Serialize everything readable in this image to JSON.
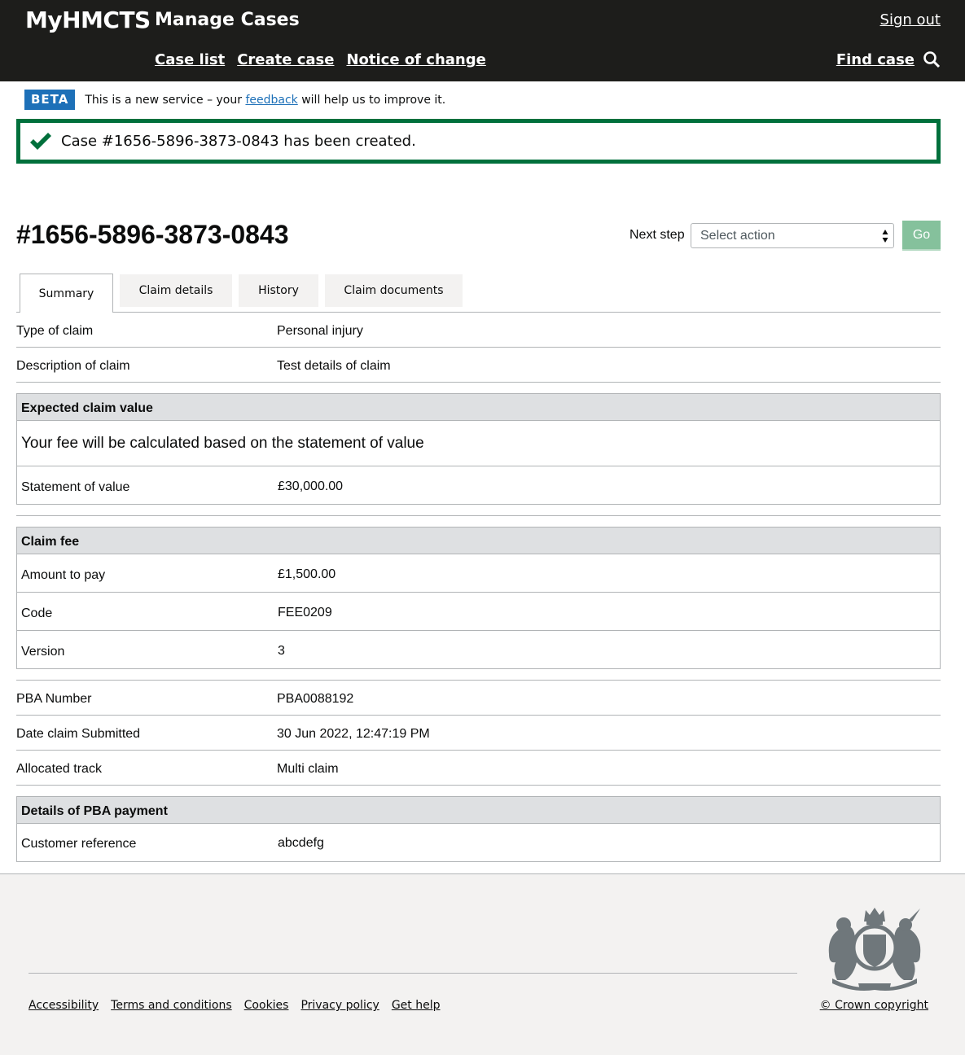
{
  "header": {
    "brand": "MyHMCTS",
    "service_name": "Manage Cases",
    "sign_out": "Sign out",
    "nav": [
      "Case list",
      "Create case",
      "Notice of change"
    ],
    "find_case": "Find case"
  },
  "beta": {
    "tag": "BETA",
    "text_before": "This is a new service – your ",
    "link": "feedback",
    "text_after": " will help us to improve it."
  },
  "alert": {
    "message": "Case #1656-5896-3873-0843 has been created.",
    "color": "#00703c"
  },
  "case": {
    "title": "#1656-5896-3873-0843",
    "next_step_label": "Next step",
    "select_placeholder": "Select action",
    "go_label": "Go"
  },
  "tabs": [
    "Summary",
    "Claim details",
    "History",
    "Claim documents"
  ],
  "summary": {
    "type_of_claim": {
      "label": "Type of claim",
      "value": "Personal injury"
    },
    "description": {
      "label": "Description of claim",
      "value": "Test details of claim"
    },
    "expected_claim_value": {
      "heading": "Expected claim value",
      "note": "Your fee will be calculated based on the statement of value",
      "statement_label": "Statement of value",
      "statement_value": "£30,000.00"
    },
    "claim_fee": {
      "heading": "Claim fee",
      "rows": [
        {
          "label": "Amount to pay",
          "value": "£1,500.00"
        },
        {
          "label": "Code",
          "value": "FEE0209"
        },
        {
          "label": "Version",
          "value": "3"
        }
      ]
    },
    "pba_number": {
      "label": "PBA Number",
      "value": "PBA0088192"
    },
    "date_submitted": {
      "label": "Date claim Submitted",
      "value": "30 Jun 2022, 12:47:19 PM"
    },
    "allocated_track": {
      "label": "Allocated track",
      "value": "Multi claim"
    },
    "pba_payment": {
      "heading": "Details of PBA payment",
      "customer_reference_label": "Customer reference",
      "customer_reference_value": "abcdefg"
    }
  },
  "footer": {
    "links": [
      "Accessibility",
      "Terms and conditions",
      "Cookies",
      "Privacy policy",
      "Get help"
    ],
    "copyright": "© Crown copyright"
  }
}
